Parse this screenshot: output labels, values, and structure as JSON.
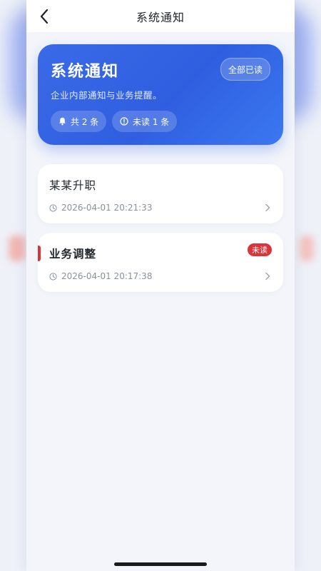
{
  "nav": {
    "title": "系统通知"
  },
  "hero": {
    "title": "系统通知",
    "subtitle": "企业内部通知与业务提醒。",
    "mark_all_label": "全部已读",
    "total_label": "共 2 条",
    "unread_label": "未读 1 条"
  },
  "notifications": [
    {
      "title": "某某升职",
      "time": "2026-04-01 20:21:33",
      "unread": false
    },
    {
      "title": "业务调整",
      "time": "2026-04-01 20:17:38",
      "unread": true,
      "badge": "未读"
    }
  ],
  "colors": {
    "primary": "#3a6ae6",
    "unread": "#d8343a",
    "background": "#f3f5fa"
  },
  "icons": [
    "back-arrow-icon",
    "bell-icon",
    "info-circle-icon",
    "clock-icon",
    "chevron-right-icon"
  ]
}
